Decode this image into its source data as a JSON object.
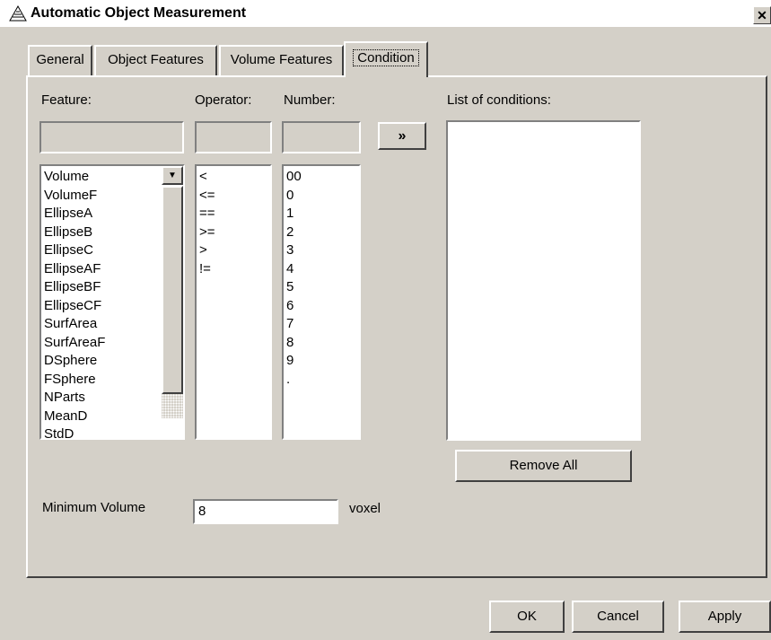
{
  "window": {
    "title": "Automatic Object Measurement",
    "close_glyph": "✕",
    "icon": "app-icon"
  },
  "tabs": [
    {
      "label": "General",
      "active": false
    },
    {
      "label": "Object Features",
      "active": false
    },
    {
      "label": "Volume Features",
      "active": false
    },
    {
      "label": "Condition",
      "active": true
    }
  ],
  "condition": {
    "feature_label": "Feature:",
    "operator_label": "Operator:",
    "number_label": "Number:",
    "conditions_label": "List of conditions:",
    "feature_value": "",
    "operator_value": "",
    "number_value": "",
    "add_button": "»",
    "remove_all_button": "Remove All",
    "features": [
      "Volume",
      "VolumeF",
      "EllipseA",
      "EllipseB",
      "EllipseC",
      "EllipseAF",
      "EllipseBF",
      "EllipseCF",
      "SurfArea",
      "SurfAreaF",
      "DSphere",
      "FSphere",
      "NParts",
      "MeanD",
      "StdD"
    ],
    "operators": [
      "<",
      "<=",
      "==",
      ">=",
      ">",
      "!="
    ],
    "numbers": [
      "00",
      "0",
      "1",
      "2",
      "3",
      "4",
      "5",
      "6",
      "7",
      "8",
      "9",
      "."
    ],
    "conditions": [],
    "min_volume_label": "Minimum Volume",
    "min_volume_value": "8",
    "min_volume_unit": "voxel"
  },
  "footer": {
    "ok": "OK",
    "cancel": "Cancel",
    "apply": "Apply"
  }
}
